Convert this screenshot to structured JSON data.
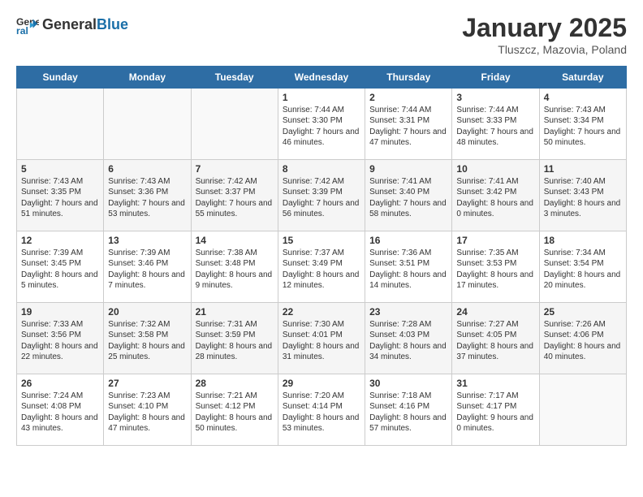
{
  "header": {
    "logo": {
      "general": "General",
      "blue": "Blue"
    },
    "title": "January 2025",
    "subtitle": "Tluszcz, Mazovia, Poland"
  },
  "days_of_week": [
    "Sunday",
    "Monday",
    "Tuesday",
    "Wednesday",
    "Thursday",
    "Friday",
    "Saturday"
  ],
  "weeks": [
    [
      {
        "day": null,
        "info": null
      },
      {
        "day": null,
        "info": null
      },
      {
        "day": null,
        "info": null
      },
      {
        "day": "1",
        "info": "Sunrise: 7:44 AM\nSunset: 3:30 PM\nDaylight: 7 hours and 46 minutes."
      },
      {
        "day": "2",
        "info": "Sunrise: 7:44 AM\nSunset: 3:31 PM\nDaylight: 7 hours and 47 minutes."
      },
      {
        "day": "3",
        "info": "Sunrise: 7:44 AM\nSunset: 3:33 PM\nDaylight: 7 hours and 48 minutes."
      },
      {
        "day": "4",
        "info": "Sunrise: 7:43 AM\nSunset: 3:34 PM\nDaylight: 7 hours and 50 minutes."
      }
    ],
    [
      {
        "day": "5",
        "info": "Sunrise: 7:43 AM\nSunset: 3:35 PM\nDaylight: 7 hours and 51 minutes."
      },
      {
        "day": "6",
        "info": "Sunrise: 7:43 AM\nSunset: 3:36 PM\nDaylight: 7 hours and 53 minutes."
      },
      {
        "day": "7",
        "info": "Sunrise: 7:42 AM\nSunset: 3:37 PM\nDaylight: 7 hours and 55 minutes."
      },
      {
        "day": "8",
        "info": "Sunrise: 7:42 AM\nSunset: 3:39 PM\nDaylight: 7 hours and 56 minutes."
      },
      {
        "day": "9",
        "info": "Sunrise: 7:41 AM\nSunset: 3:40 PM\nDaylight: 7 hours and 58 minutes."
      },
      {
        "day": "10",
        "info": "Sunrise: 7:41 AM\nSunset: 3:42 PM\nDaylight: 8 hours and 0 minutes."
      },
      {
        "day": "11",
        "info": "Sunrise: 7:40 AM\nSunset: 3:43 PM\nDaylight: 8 hours and 3 minutes."
      }
    ],
    [
      {
        "day": "12",
        "info": "Sunrise: 7:39 AM\nSunset: 3:45 PM\nDaylight: 8 hours and 5 minutes."
      },
      {
        "day": "13",
        "info": "Sunrise: 7:39 AM\nSunset: 3:46 PM\nDaylight: 8 hours and 7 minutes."
      },
      {
        "day": "14",
        "info": "Sunrise: 7:38 AM\nSunset: 3:48 PM\nDaylight: 8 hours and 9 minutes."
      },
      {
        "day": "15",
        "info": "Sunrise: 7:37 AM\nSunset: 3:49 PM\nDaylight: 8 hours and 12 minutes."
      },
      {
        "day": "16",
        "info": "Sunrise: 7:36 AM\nSunset: 3:51 PM\nDaylight: 8 hours and 14 minutes."
      },
      {
        "day": "17",
        "info": "Sunrise: 7:35 AM\nSunset: 3:53 PM\nDaylight: 8 hours and 17 minutes."
      },
      {
        "day": "18",
        "info": "Sunrise: 7:34 AM\nSunset: 3:54 PM\nDaylight: 8 hours and 20 minutes."
      }
    ],
    [
      {
        "day": "19",
        "info": "Sunrise: 7:33 AM\nSunset: 3:56 PM\nDaylight: 8 hours and 22 minutes."
      },
      {
        "day": "20",
        "info": "Sunrise: 7:32 AM\nSunset: 3:58 PM\nDaylight: 8 hours and 25 minutes."
      },
      {
        "day": "21",
        "info": "Sunrise: 7:31 AM\nSunset: 3:59 PM\nDaylight: 8 hours and 28 minutes."
      },
      {
        "day": "22",
        "info": "Sunrise: 7:30 AM\nSunset: 4:01 PM\nDaylight: 8 hours and 31 minutes."
      },
      {
        "day": "23",
        "info": "Sunrise: 7:28 AM\nSunset: 4:03 PM\nDaylight: 8 hours and 34 minutes."
      },
      {
        "day": "24",
        "info": "Sunrise: 7:27 AM\nSunset: 4:05 PM\nDaylight: 8 hours and 37 minutes."
      },
      {
        "day": "25",
        "info": "Sunrise: 7:26 AM\nSunset: 4:06 PM\nDaylight: 8 hours and 40 minutes."
      }
    ],
    [
      {
        "day": "26",
        "info": "Sunrise: 7:24 AM\nSunset: 4:08 PM\nDaylight: 8 hours and 43 minutes."
      },
      {
        "day": "27",
        "info": "Sunrise: 7:23 AM\nSunset: 4:10 PM\nDaylight: 8 hours and 47 minutes."
      },
      {
        "day": "28",
        "info": "Sunrise: 7:21 AM\nSunset: 4:12 PM\nDaylight: 8 hours and 50 minutes."
      },
      {
        "day": "29",
        "info": "Sunrise: 7:20 AM\nSunset: 4:14 PM\nDaylight: 8 hours and 53 minutes."
      },
      {
        "day": "30",
        "info": "Sunrise: 7:18 AM\nSunset: 4:16 PM\nDaylight: 8 hours and 57 minutes."
      },
      {
        "day": "31",
        "info": "Sunrise: 7:17 AM\nSunset: 4:17 PM\nDaylight: 9 hours and 0 minutes."
      },
      {
        "day": null,
        "info": null
      }
    ]
  ]
}
